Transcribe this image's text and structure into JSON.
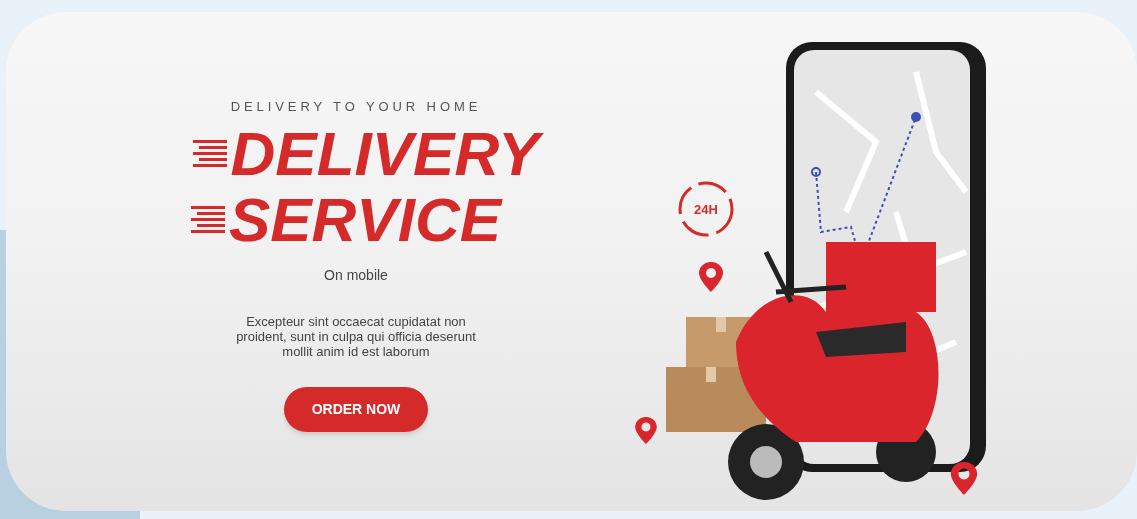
{
  "banner": {
    "eyebrow": "DELIVERY TO YOUR HOME",
    "title_lines": [
      "DELIVERY",
      "SERVICE"
    ],
    "subtitle": "On mobile",
    "body": "Excepteur sint occaecat cupidatat non proident, sunt in culpa qui officia deserunt mollit anim id est laborum",
    "button": "ORDER NOW",
    "badge": "24H"
  }
}
